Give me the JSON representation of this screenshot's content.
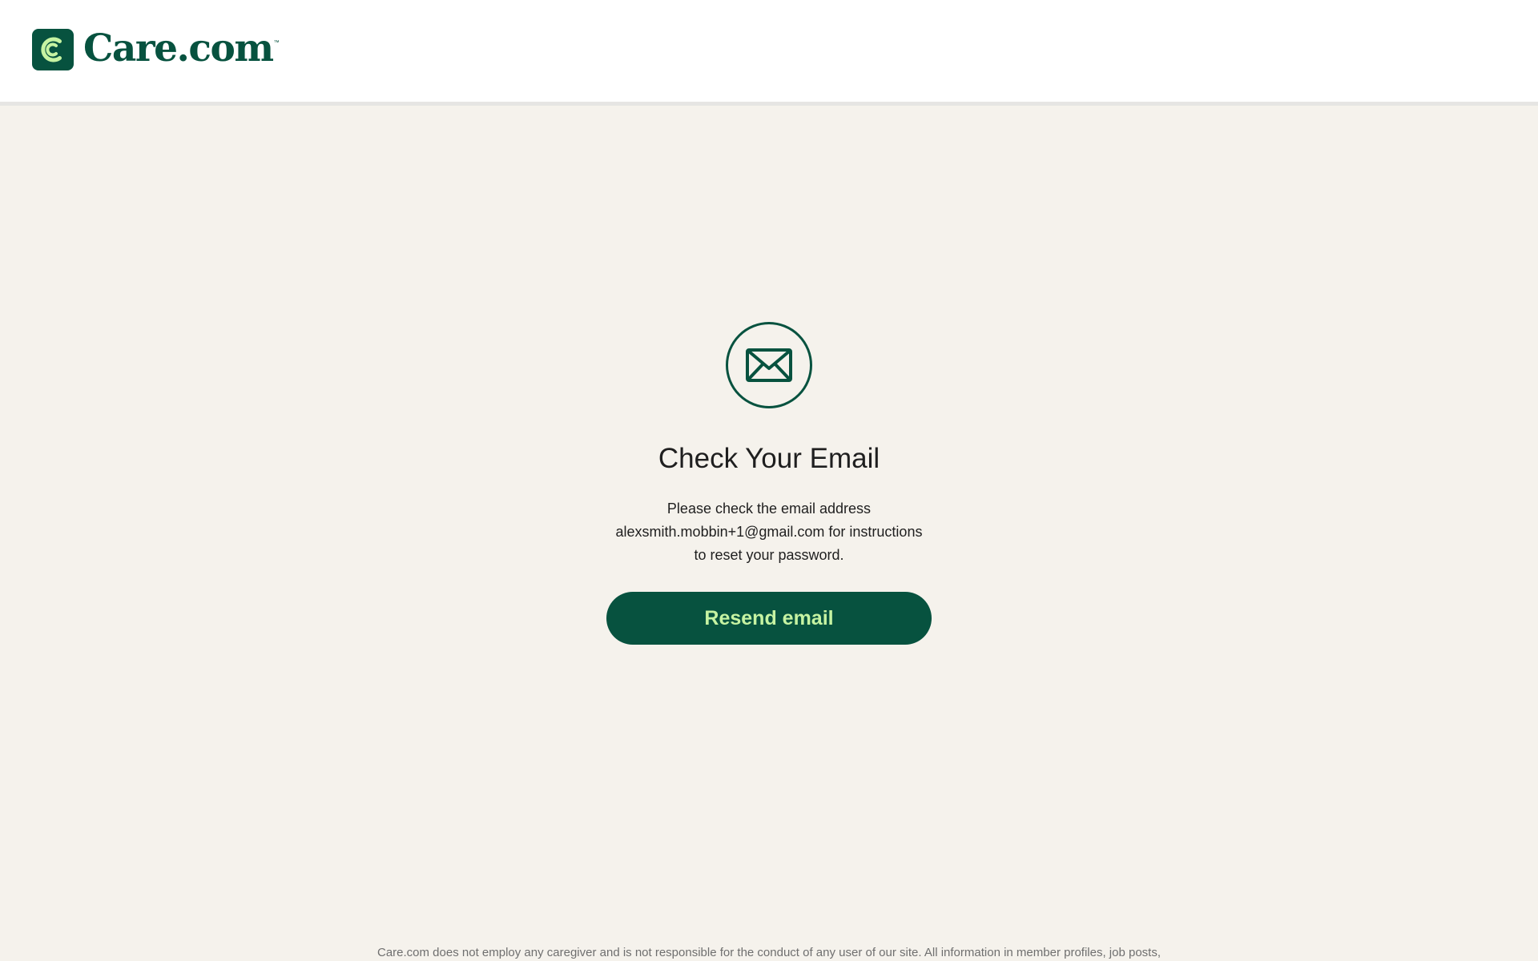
{
  "header": {
    "logo_text": "Care.com",
    "logo_tm": "™"
  },
  "main": {
    "icon": "mail-icon",
    "title": "Check Your Email",
    "description": "Please check the email address alexsmith.mobbin+1@gmail.com for instructions to reset your password.",
    "resend_label": "Resend email"
  },
  "footer": {
    "disclaimer": "Care.com does not employ any caregiver and is not responsible for the conduct of any user of our site. All information in member profiles, job posts,"
  },
  "colors": {
    "brand_green": "#07523f",
    "button_text": "#c6f3a2",
    "page_background": "#f5f2ec",
    "header_background": "#ffffff"
  }
}
